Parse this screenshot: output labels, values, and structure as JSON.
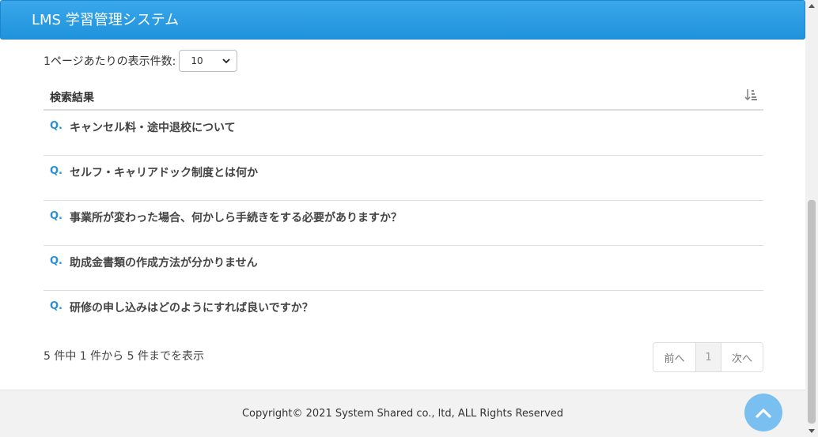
{
  "header": {
    "title": "LMS 学習管理システム"
  },
  "perpage": {
    "label": "1ページあたりの表示件数:",
    "selected": "10"
  },
  "results": {
    "heading": "検索結果",
    "q_prefix": "Q.",
    "items": [
      {
        "text": "キャンセル料・途中退校について"
      },
      {
        "text": "セルフ・キャリアドック制度とは何か"
      },
      {
        "text": "事業所が変わった場合、何かしら手続きをする必要がありますか？"
      },
      {
        "text": "助成金書類の作成方法が分かりません"
      },
      {
        "text": "研修の申し込みはどのようにすれば良いですか？"
      }
    ]
  },
  "summary": "5 件中 1 件から 5 件までを表示",
  "pagination": {
    "prev": "前へ",
    "page": "1",
    "next": "次へ"
  },
  "footer": {
    "copyright": "Copyright© 2021 System Shared co., ltd, ALL Rights Reserved"
  },
  "icons": {
    "sort": "sort-amount-down-icon",
    "to_top": "chevron-up-icon"
  },
  "colors": {
    "header": "#1f93dd",
    "accent": "#2b8fd4",
    "to_top": "#79bff0"
  }
}
